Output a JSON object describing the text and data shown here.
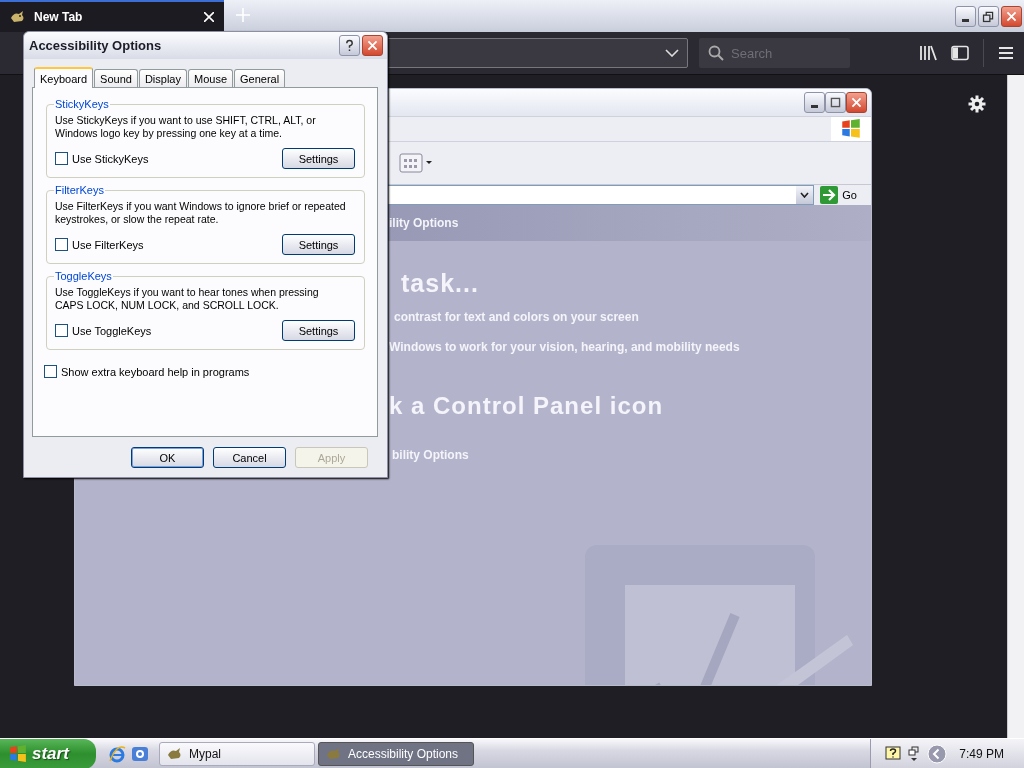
{
  "browser": {
    "tab": {
      "title": "New Tab"
    },
    "search": {
      "placeholder": "Search"
    }
  },
  "control_panel": {
    "go_button": "Go",
    "header": "ility Options",
    "heading_1": "task...",
    "tasks": [
      "contrast for text and colors on your screen",
      "Windows to work for your vision, hearing, and mobility needs"
    ],
    "heading_2": "k a Control Panel icon",
    "icons": [
      "bility Options"
    ]
  },
  "dialog": {
    "title": "Accessibility Options",
    "tabs": [
      {
        "label": "Keyboard",
        "selected": true
      },
      {
        "label": "Sound",
        "selected": false
      },
      {
        "label": "Display",
        "selected": false
      },
      {
        "label": "Mouse",
        "selected": false
      },
      {
        "label": "General",
        "selected": false
      }
    ],
    "groups": [
      {
        "title": "StickyKeys",
        "description": "Use StickyKeys if you want to use SHIFT, CTRL, ALT, or Windows logo key by pressing one key at a time.",
        "checkbox": {
          "label": "Use StickyKeys",
          "checked": false
        },
        "button": "Settings"
      },
      {
        "title": "FilterKeys",
        "description": "Use FilterKeys if you want Windows to ignore brief or repeated keystrokes, or slow the repeat rate.",
        "checkbox": {
          "label": "Use FilterKeys",
          "checked": false
        },
        "button": "Settings"
      },
      {
        "title": "ToggleKeys",
        "description": "Use ToggleKeys if you want to hear tones when pressing CAPS LOCK, NUM LOCK, and SCROLL LOCK.",
        "checkbox": {
          "label": "Use ToggleKeys",
          "checked": false
        },
        "button": "Settings"
      }
    ],
    "extra_checkbox": {
      "label": "Show extra keyboard help in programs",
      "checked": false
    },
    "buttons": [
      {
        "label": "OK",
        "default": true,
        "disabled": false
      },
      {
        "label": "Cancel",
        "default": false,
        "disabled": false
      },
      {
        "label": "Apply",
        "default": false,
        "disabled": true
      }
    ]
  },
  "taskbar": {
    "start": "start",
    "tasks": [
      {
        "label": "Mypal",
        "selected": false
      },
      {
        "label": "Accessibility Options",
        "selected": true
      }
    ],
    "clock": "7:49 PM"
  }
}
